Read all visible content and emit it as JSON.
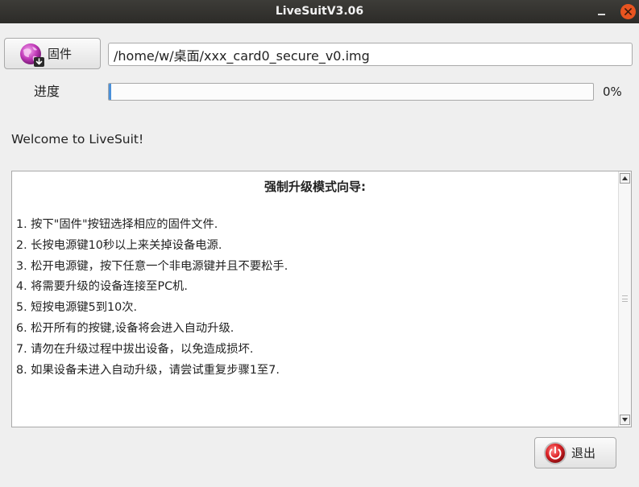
{
  "window": {
    "title": "LiveSuitV3.06",
    "minimize_icon": "minimize-icon",
    "close_icon": "close-icon",
    "close_color": "#e95420"
  },
  "firmware": {
    "button_label": "固件",
    "button_icon": "firmware-globe-download-icon",
    "path_value": "/home/w/桌面/xxx_card0_secure_v0.img"
  },
  "progress": {
    "label": "进度",
    "value": 0,
    "percent_text": "0%"
  },
  "status": {
    "welcome": "Welcome to LiveSuit!"
  },
  "guide": {
    "title": "强制升级模式向导:",
    "steps": [
      "1. 按下\"固件\"按钮选择相应的固件文件.",
      "2. 长按电源键10秒以上来关掉设备电源.",
      "3. 松开电源键，按下任意一个非电源键并且不要松手.",
      "4. 将需要升级的设备连接至PC机.",
      "5. 短按电源键5到10次.",
      "6. 松开所有的按键,设备将会进入自动升级.",
      "7. 请勿在升级过程中拔出设备，以免造成损坏.",
      "8. 如果设备未进入自动升级，请尝试重复步骤1至7."
    ]
  },
  "footer": {
    "exit_label": "退出",
    "exit_icon": "exit-power-icon"
  }
}
